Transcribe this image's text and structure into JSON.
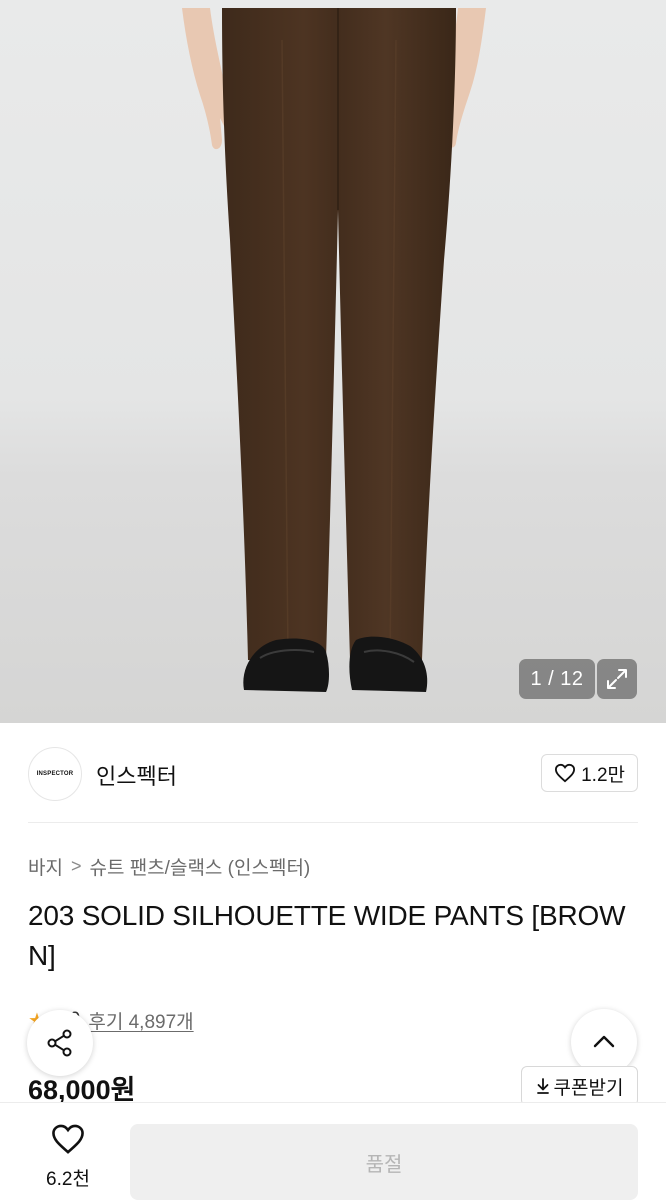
{
  "gallery": {
    "counter": "1 / 12",
    "expand_icon": "expand-icon"
  },
  "brand": {
    "logo_text": "INSPECTOR",
    "name": "인스펙터",
    "like_count": "1.2만"
  },
  "breadcrumb": {
    "items": [
      "바지",
      "슈트 팬츠/슬랙스 (인스펙터)"
    ],
    "separator": ">"
  },
  "product": {
    "title": "203 SOLID SILHOUETTE WIDE PANTS [BROWN]",
    "rating_score": "4.9",
    "review_text": "후기 4,897개",
    "price": "68,000원",
    "coupon_label": "쿠폰받기"
  },
  "bottom_bar": {
    "wish_count": "6.2천",
    "buy_label": "품절"
  },
  "colors": {
    "star": "#f5a623",
    "sold_out_bg": "#efefef",
    "sold_out_text": "#b5b5b5"
  }
}
